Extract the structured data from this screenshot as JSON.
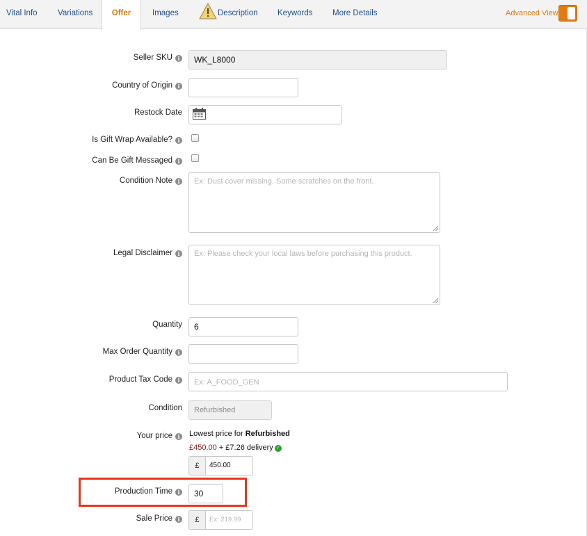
{
  "tabs": [
    {
      "label": "Vital Info"
    },
    {
      "label": "Variations"
    },
    {
      "label": "Offer"
    },
    {
      "label": "Images"
    },
    {
      "label": "Description"
    },
    {
      "label": "Keywords"
    },
    {
      "label": "More Details"
    }
  ],
  "active_tab": "Offer",
  "advanced_view": {
    "label": "Advanced View",
    "enabled": true
  },
  "form": {
    "seller_sku": {
      "label": "Seller SKU",
      "value": "WK_L8000"
    },
    "country_of_origin": {
      "label": "Country of Origin",
      "value": ""
    },
    "restock_date": {
      "label": "Restock Date",
      "value": ""
    },
    "gift_wrap": {
      "label": "Is Gift Wrap Available?",
      "checked": false
    },
    "gift_message": {
      "label": "Can Be Gift Messaged",
      "checked": false
    },
    "condition_note": {
      "label": "Condition Note",
      "placeholder": "Ex: Dust cover missing. Some scratches on the front."
    },
    "legal_disclaimer": {
      "label": "Legal Disclaimer",
      "placeholder": "Ex: Please check your local laws before purchasing this product."
    },
    "quantity": {
      "label": "Quantity",
      "value": "6"
    },
    "max_order_quantity": {
      "label": "Max Order Quantity",
      "value": ""
    },
    "product_tax_code": {
      "label": "Product Tax Code",
      "placeholder": "Ex: A_FOOD_GEN"
    },
    "condition": {
      "label": "Condition",
      "value": "Refurbished"
    },
    "your_price": {
      "label": "Your price",
      "lowest_prefix": "Lowest price for",
      "lowest_condition": "Refurbished",
      "lowest_amount": "£450.00",
      "delivery": "+ £7.26 delivery",
      "currency": "£",
      "value": "450.00"
    },
    "production_time": {
      "label": "Production Time",
      "value": "30"
    },
    "sale_price": {
      "label": "Sale Price",
      "currency": "£",
      "placeholder": "Ex: 219.99"
    }
  },
  "colors": {
    "accent": "#e47911",
    "link": "#1f4e8c",
    "highlight": "#e8361e",
    "price": "#8c1d1d"
  }
}
